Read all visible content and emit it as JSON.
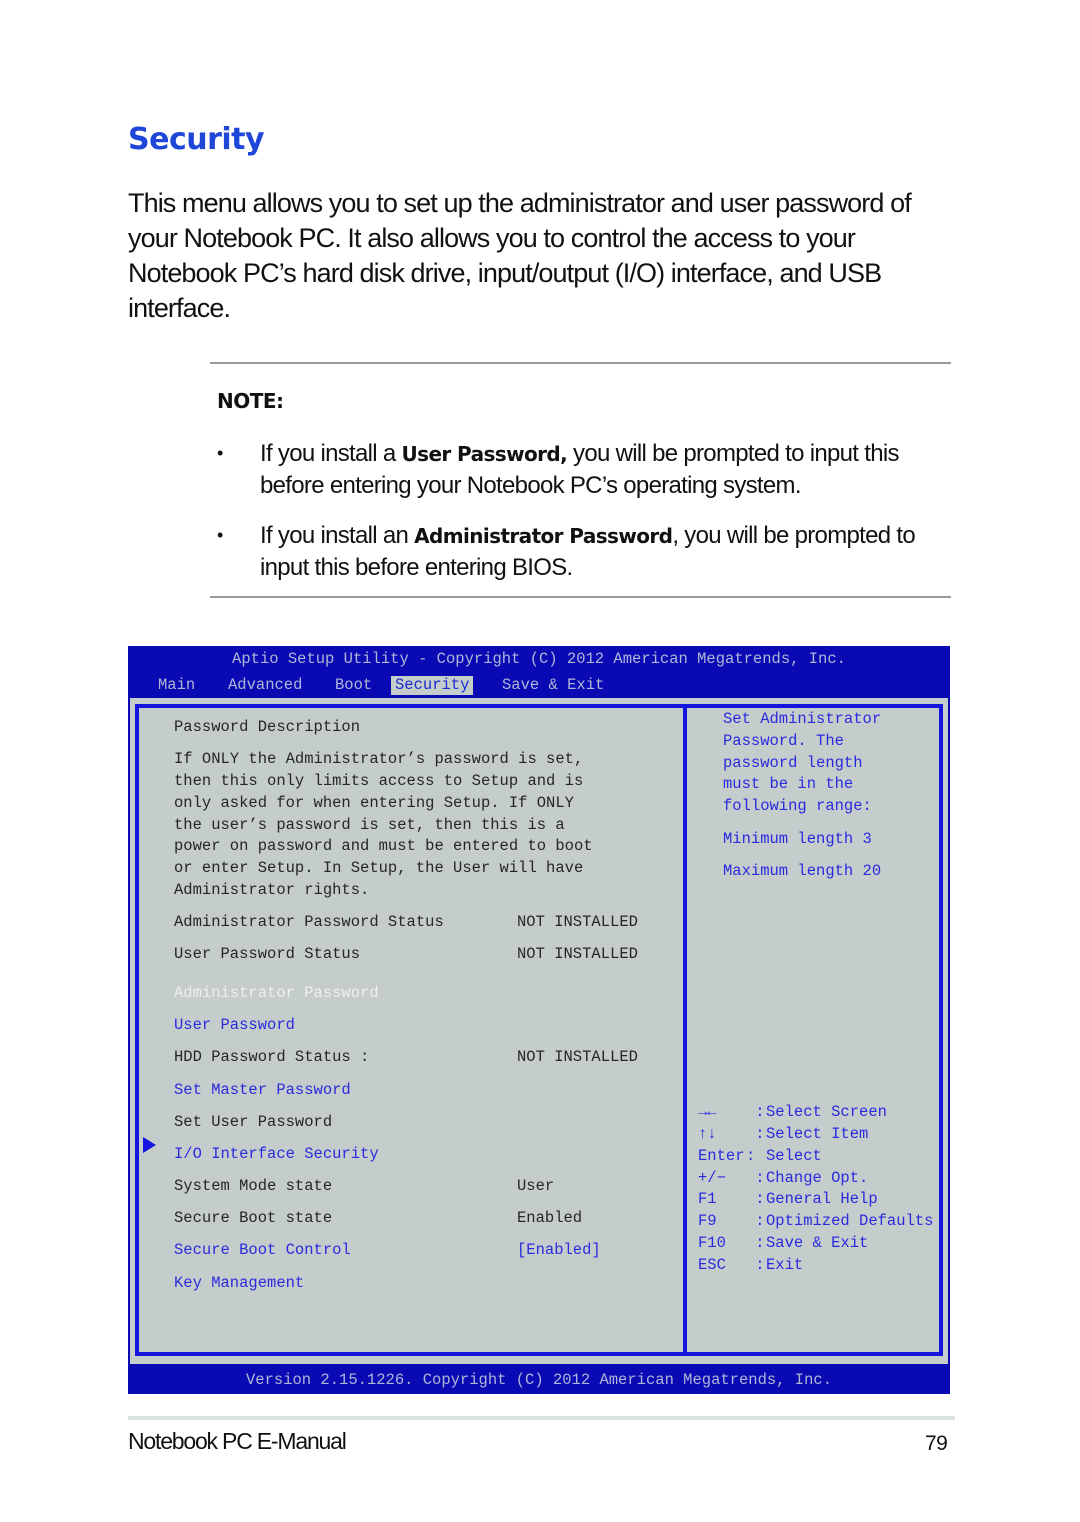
{
  "page": {
    "section_title": "Security",
    "intro": "This menu allows you to set up the administrator and user password of your Notebook PC. It also allows you to control the access to your Notebook PC’s hard disk drive, input/output (I/O) interface, and USB interface.",
    "note": {
      "title": "NOTE:",
      "bullet": "•",
      "items": [
        {
          "before": "If you install a ",
          "bold": "User Password,",
          "after": " you will be prompted to input this before entering your Notebook PC’s operating system."
        },
        {
          "before": "If you install an ",
          "bold": "Administrator Password",
          "after": ", you will be prompted to input this before entering BIOS."
        }
      ]
    },
    "footer": {
      "manual_title": "Notebook PC E-Manual",
      "page_number": "79"
    }
  },
  "bios": {
    "title": "Aptio Setup Utility - Copyright (C) 2012 American Megatrends, Inc.",
    "tabs": [
      {
        "label": "Main",
        "active": false
      },
      {
        "label": "Advanced",
        "active": false
      },
      {
        "label": "Boot",
        "active": false
      },
      {
        "label": "Security",
        "active": true
      },
      {
        "label": "Save & Exit",
        "active": false
      }
    ],
    "description_heading": "Password Description",
    "description_lines": [
      "If ONLY the Administrator’s password is set,",
      "then this only limits access to Setup and is",
      "only asked for when entering Setup. If ONLY",
      "the user’s password is set, then this is a",
      "power on password and must be entered to boot",
      "or enter Setup. In Setup, the User will have",
      "Administrator rights."
    ],
    "items": [
      {
        "label": "Administrator Password Status",
        "value": "NOT INSTALLED",
        "type": "info"
      },
      {
        "label": "User Password Status",
        "value": "NOT INSTALLED",
        "type": "info"
      },
      {
        "label": "Administrator Password",
        "value": "",
        "type": "selected"
      },
      {
        "label": "User Password",
        "value": "",
        "type": "link"
      },
      {
        "label": "HDD Password Status :",
        "value": "NOT INSTALLED",
        "type": "info"
      },
      {
        "label": "Set Master Password",
        "value": "",
        "type": "link"
      },
      {
        "label": "Set User Password",
        "value": "",
        "type": "info"
      },
      {
        "label": "I/O Interface Security",
        "value": "",
        "type": "submenu"
      },
      {
        "label": "System Mode state",
        "value": "User",
        "type": "info"
      },
      {
        "label": "Secure Boot state",
        "value": "Enabled",
        "type": "info"
      },
      {
        "label": "Secure Boot Control",
        "value": "[Enabled]",
        "type": "link"
      },
      {
        "label": "Key Management",
        "value": "",
        "type": "link"
      }
    ],
    "help": {
      "lines": [
        "Set Administrator",
        "Password. The",
        "password length",
        "must be in the",
        "following range:"
      ],
      "min": "Minimum length 3",
      "max": "Maximum length 20"
    },
    "keys": [
      {
        "key": "→←",
        "sep": " : ",
        "action": "Select Screen"
      },
      {
        "key": "↑↓",
        "sep": " : ",
        "action": "Select Item"
      },
      {
        "key": "Enter",
        "sep": ": ",
        "action": "Select"
      },
      {
        "key": "+/−",
        "sep": " : ",
        "action": "Change Opt."
      },
      {
        "key": "F1",
        "sep": " : ",
        "action": "General Help"
      },
      {
        "key": "F9",
        "sep": " : ",
        "action": "Optimized Defaults"
      },
      {
        "key": "F10",
        "sep": " : ",
        "action": "Save & Exit"
      },
      {
        "key": "ESC",
        "sep": " : ",
        "action": "Exit"
      }
    ],
    "version": "Version 2.15.1226. Copyright (C) 2012 American Megatrends, Inc.",
    "colors": {
      "frame_blue": "#0a0ab4",
      "border_blue": "#1515e0",
      "panel_gray": "#c4cccc",
      "link_blue": "#2b2bde"
    }
  }
}
